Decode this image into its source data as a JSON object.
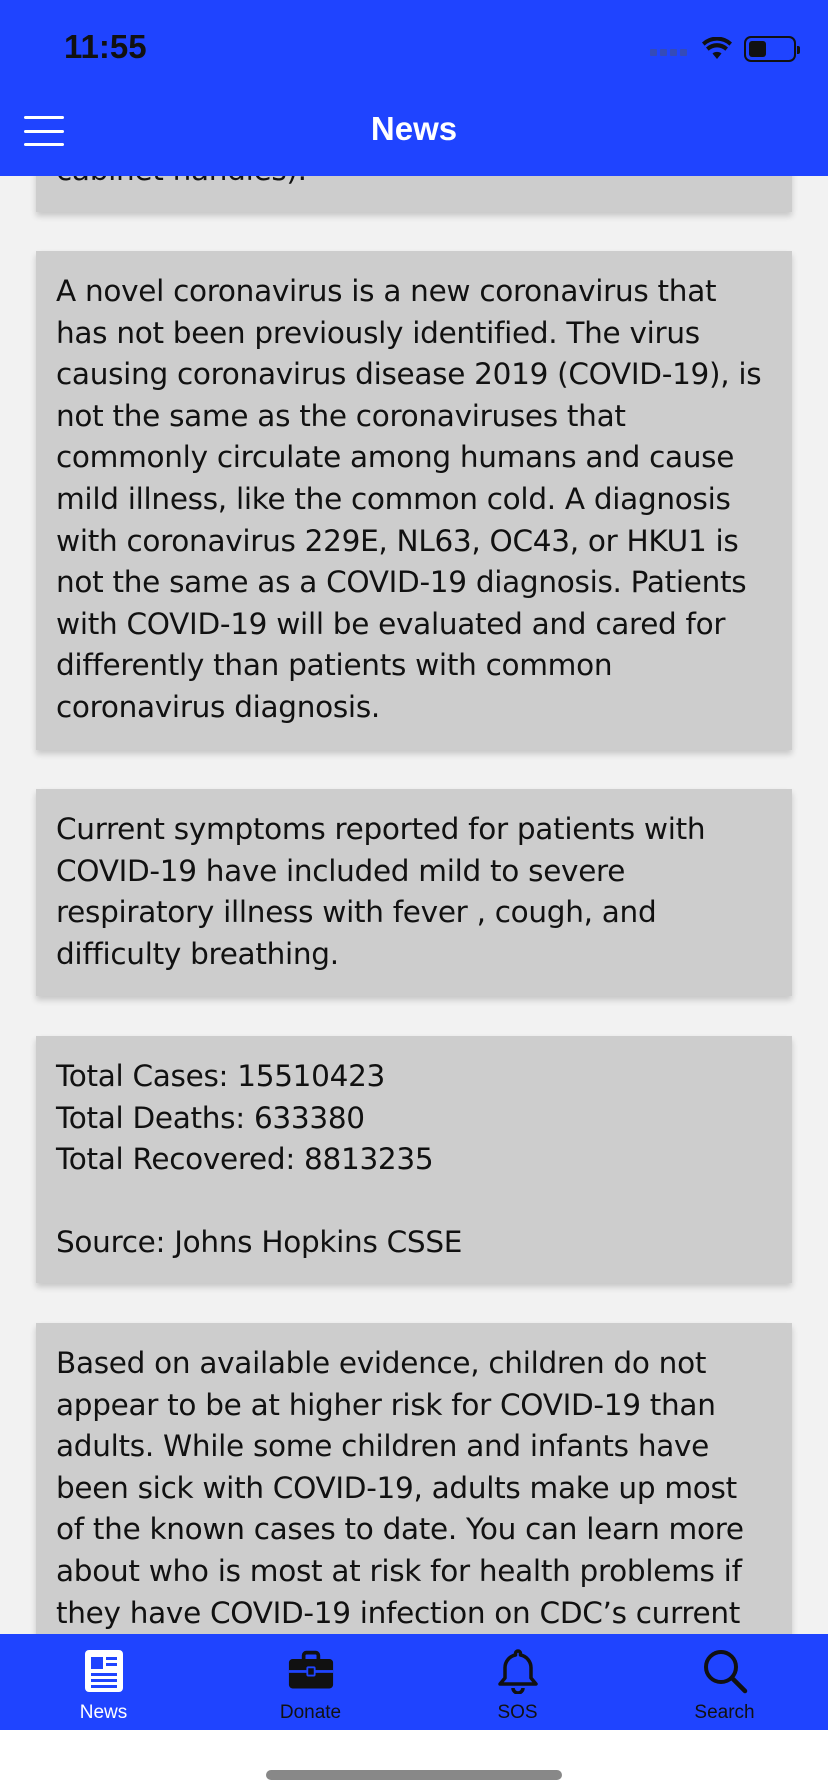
{
  "status_bar": {
    "time": "11:55"
  },
  "nav": {
    "title": "News"
  },
  "cards": [
    {
      "text": "cabinet handles)."
    },
    {
      "text": "A novel coronavirus is a new coronavirus that has not been previously identified. The virus causing coronavirus disease 2019 (COVID-19), is not the same as the coronaviruses that commonly circulate among humans and cause mild illness, like the common cold. A diagnosis with coronavirus 229E, NL63, OC43, or HKU1 is not the same as a COVID-19 diagnosis. Patients with COVID-19 will be evaluated and cared for differently than patients with common coronavirus diagnosis."
    },
    {
      "text": "Current symptoms reported for patients with COVID-19 have included mild to severe respiratory illness with fever , cough, and difficulty breathing."
    },
    {
      "text": "Total Cases: 15510423\nTotal Deaths: 633380\nTotal Recovered: 8813235\n\nSource: Johns Hopkins CSSE"
    },
    {
      "text": "Based on available evidence, children do not appear to be at higher risk for COVID-19 than adults. While some children and infants have been sick with COVID-19, adults make up most of the known cases to date. You can learn more about who is most at risk for health problems if they have COVID-19 infection on CDC’s current"
    }
  ],
  "tabbar": {
    "tabs": [
      {
        "label": "News",
        "icon": "newspaper-icon",
        "active": true
      },
      {
        "label": "Donate",
        "icon": "briefcase-icon",
        "active": false
      },
      {
        "label": "SOS",
        "icon": "bell-icon",
        "active": false
      },
      {
        "label": "Search",
        "icon": "search-icon",
        "active": false
      }
    ]
  },
  "colors": {
    "header": "#1f44ff",
    "card": "#cdcdcd",
    "background": "#f2f2f2"
  }
}
